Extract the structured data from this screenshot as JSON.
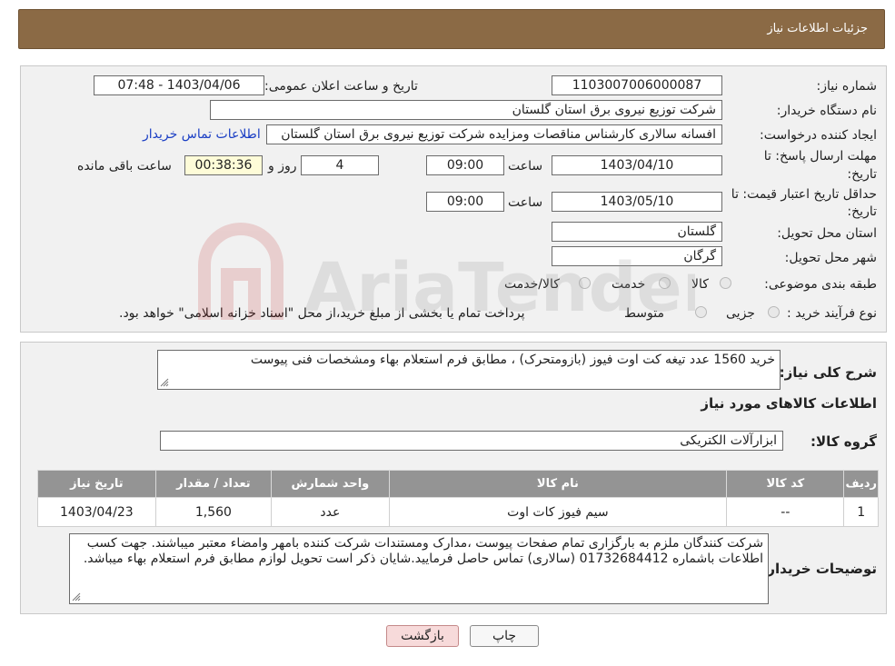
{
  "header": {
    "title": "جزئیات اطلاعات نیاز"
  },
  "form": {
    "need_number_label": "شماره نیاز:",
    "need_number": "1103007006000087",
    "announce_label": "تاریخ و ساعت اعلان عمومی:",
    "announce_value": "1403/04/06 - 07:48",
    "buyer_org_label": "نام دستگاه خریدار:",
    "buyer_org": "شرکت توزیع نیروی برق استان گلستان",
    "creator_label": "ایجاد کننده درخواست:",
    "creator": "افسانه سالاری کارشناس مناقصات ومزایده شرکت توزیع نیروی برق استان گلستان",
    "contact_link": "اطلاعات تماس خریدار",
    "deadline_label_1": "مهلت ارسال پاسخ: تا",
    "deadline_label_2": "تاریخ:",
    "deadline_date": "1403/04/10",
    "time_label": "ساعت",
    "deadline_time": "09:00",
    "days_value": "4",
    "days_label": "روز و",
    "remaining_time": "00:38:36",
    "remaining_label": "ساعت باقی مانده",
    "validity_label_1": "حداقل تاریخ اعتبار قیمت: تا",
    "validity_label_2": "تاریخ:",
    "validity_date": "1403/05/10",
    "validity_time": "09:00",
    "province_label": "استان محل تحویل:",
    "province": "گلستان",
    "city_label": "شهر محل تحویل:",
    "city": "گرگان",
    "category_label": "طبقه بندی موضوعی:",
    "category_options": [
      "کالا",
      "خدمت",
      "کالا/خدمت"
    ],
    "process_label": "نوع فرآیند خرید :",
    "process_options": [
      "جزیی",
      "متوسط"
    ],
    "process_note": "پرداخت تمام یا بخشی از مبلغ خرید،از محل \"اسناد خزانه اسلامی\" خواهد بود."
  },
  "details": {
    "summary_label": "شرح کلی نیاز:",
    "summary": "خرید 1560 عدد تیغه کت اوت فیوز (بازومتحرک) ، مطابق فرم استعلام بهاء ومشخصات فنی پیوست",
    "items_heading": "اطلاعات کالاهای مورد نیاز",
    "group_label": "گروه کالا:",
    "group": "ابزارآلات الکتریکی",
    "table": {
      "headers": [
        "ردیف",
        "کد کالا",
        "نام کالا",
        "واحد شمارش",
        "تعداد / مقدار",
        "تاریخ نیاز"
      ],
      "rows": [
        [
          "1",
          "--",
          "سیم فیوز کات اوت",
          "عدد",
          "1,560",
          "1403/04/23"
        ]
      ]
    },
    "buyer_notes_label": "توضیحات خریدار:",
    "buyer_notes": "شرکت کنندگان ملزم به بارگزاری تمام صفحات پیوست ،مدارک ومستندات شرکت کننده بامهر وامضاء معتبر میباشند. جهت کسب اطلاعات باشماره 01732684412 (سالاری) تماس حاصل فرمایید.شایان ذکر است تحویل لوازم مطابق فرم استعلام بهاء میباشد."
  },
  "buttons": {
    "print": "چاپ",
    "back": "بازگشت"
  },
  "watermark": {
    "text": "AriaTender.neT"
  },
  "colors": {
    "header": "#8b6a45",
    "panel": "#f1f1f1",
    "table_header": "#949494",
    "link": "#1a3ec4",
    "back_button": "#f7dada"
  }
}
